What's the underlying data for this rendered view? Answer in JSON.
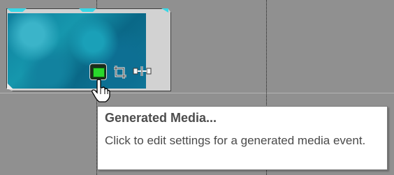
{
  "tooltip": {
    "title": "Generated Media...",
    "body": "Click to edit settings for a generated media event."
  },
  "event": {
    "icons": [
      "generated-media-icon",
      "crop-icon",
      "envelope-icon"
    ],
    "accent_color": "#37d7e6",
    "active_button_color": "#29d82c"
  }
}
